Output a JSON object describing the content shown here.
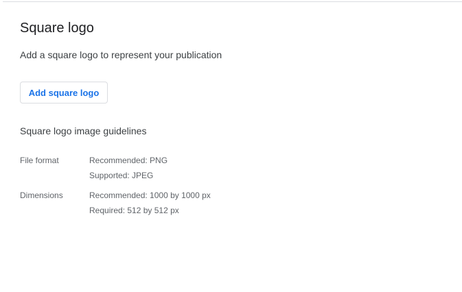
{
  "section": {
    "title": "Square logo",
    "description": "Add a square logo to represent your publication",
    "add_button_label": "Add square logo",
    "guidelines_heading": "Square logo image guidelines",
    "guidelines": [
      {
        "label": "File format",
        "values": [
          "Recommended: PNG",
          "Supported: JPEG"
        ]
      },
      {
        "label": "Dimensions",
        "values": [
          "Recommended: 1000 by 1000 px",
          "Required: 512 by 512 px"
        ]
      }
    ]
  },
  "colors": {
    "accent": "#1a73e8",
    "title_text": "#202124",
    "body_text": "#3c4043",
    "secondary_text": "#5f6368",
    "border": "#dadce0"
  }
}
